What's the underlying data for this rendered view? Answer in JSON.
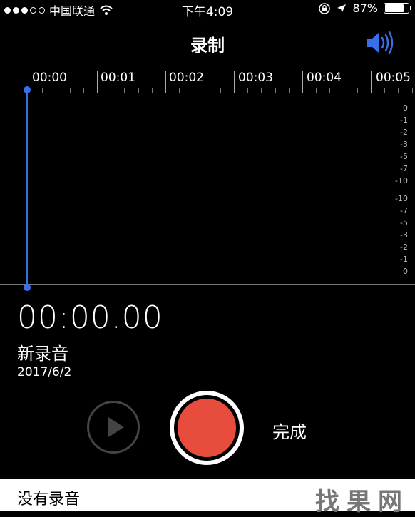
{
  "status_bar": {
    "carrier": "中国联通",
    "time": "下午4:09",
    "battery": "87%",
    "battery_level": 0.87,
    "icons": [
      "signal-dots-icon",
      "wifi-icon",
      "rotation-lock-icon",
      "location-arrow-icon",
      "battery-icon"
    ]
  },
  "nav": {
    "title": "录制",
    "speaker_icon": "speaker-icon"
  },
  "timeline": {
    "labels": [
      "00:00",
      "00:01",
      "00:02",
      "00:03",
      "00:04",
      "00:05"
    ]
  },
  "waveform": {
    "db_top": [
      "0",
      "-1",
      "-2",
      "-3",
      "-5",
      "-7",
      "-10"
    ],
    "db_bottom": [
      "-10",
      "-7",
      "-5",
      "-3",
      "-2",
      "-1",
      "0"
    ],
    "playhead_color": "#3a6ee8"
  },
  "recording": {
    "elapsed": "00:00.00",
    "name": "新录音",
    "date": "2017/6/2"
  },
  "controls": {
    "done_label": "完成",
    "record_color": "#e74c3c",
    "play_icon": "play-icon"
  },
  "list": {
    "empty_label": "没有录音"
  },
  "watermark": {
    "text": "找果网"
  }
}
